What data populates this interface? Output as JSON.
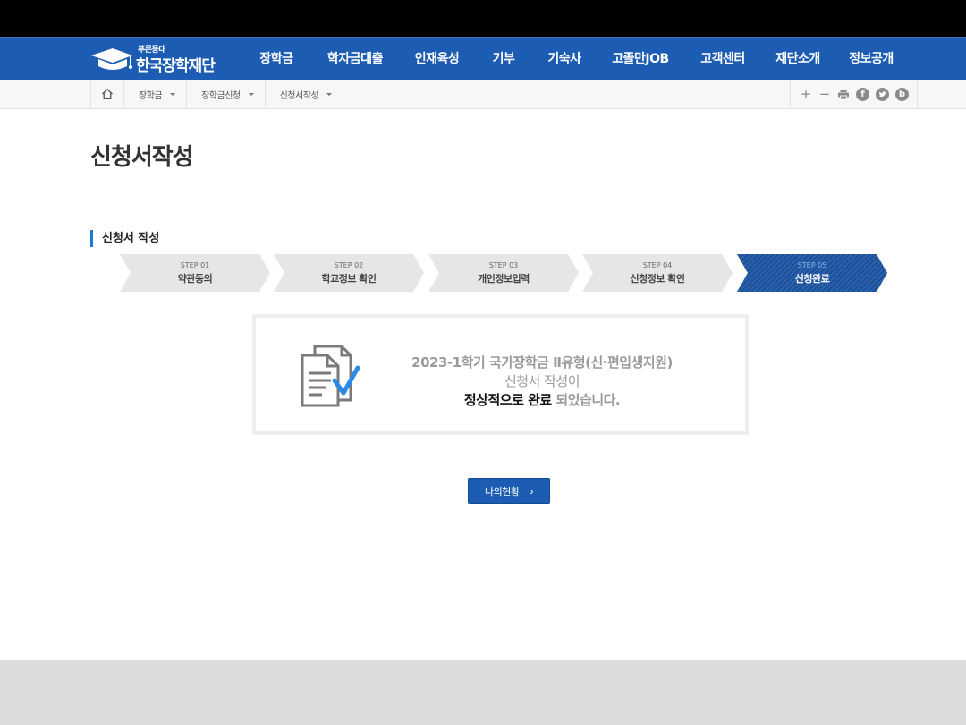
{
  "header": {
    "logo_sub": "푸른등대",
    "logo_main": "한국장학재단",
    "menu": [
      {
        "label": "장학금"
      },
      {
        "label": "학자금대출"
      },
      {
        "label": "인재육성"
      },
      {
        "label": "기부"
      },
      {
        "label": "기숙사"
      },
      {
        "label": "고졸만JOB"
      },
      {
        "label": "고객센터"
      },
      {
        "label": "재단소개"
      },
      {
        "label": "정보공개"
      }
    ]
  },
  "location": {
    "home_icon": "home-icon",
    "items": [
      {
        "label": "장학금"
      },
      {
        "label": "장학금신청"
      },
      {
        "label": "신청서작성"
      }
    ],
    "tools": {
      "zoom_in": "+",
      "zoom_out": "−",
      "facebook": "f",
      "blog": "b"
    }
  },
  "page": {
    "title": "신청서작성",
    "section_title": "신청서 작성"
  },
  "steps": [
    {
      "no": "STEP 01",
      "label": "약관동의"
    },
    {
      "no": "STEP 02",
      "label": "학교정보 확인"
    },
    {
      "no": "STEP 03",
      "label": "개인정보입력"
    },
    {
      "no": "STEP 04",
      "label": "신청정보 확인"
    },
    {
      "no": "STEP 05",
      "label": "신청완료"
    }
  ],
  "active_step": 5,
  "result": {
    "line1": "2023-1학기 국가장학금 Ⅱ유형(신·편입생지원)",
    "line2": "신청서 작성이",
    "line3_strong": "정상적으로 완료",
    "line3_rest": " 되었습니다."
  },
  "button": {
    "my_status": "나의현황"
  },
  "colors": {
    "brand_blue": "#1c5cb2",
    "accent": "#1c7ad6",
    "check": "#2a8ae6"
  }
}
